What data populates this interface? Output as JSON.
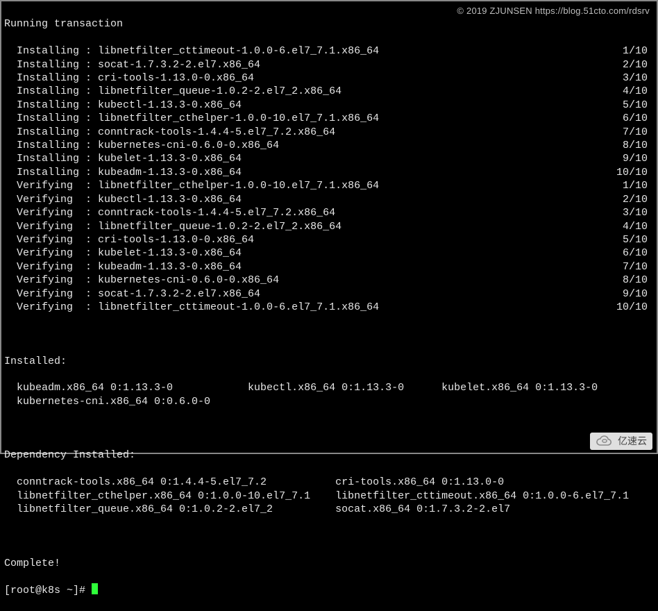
{
  "watermark": "© 2019 ZJUNSEN https://blog.51cto.com/rdsrv",
  "header": "Running transaction",
  "steps": [
    {
      "action": "Installing",
      "pkg": "libnetfilter_cttimeout-1.0.0-6.el7_7.1.x86_64",
      "n": "1/10"
    },
    {
      "action": "Installing",
      "pkg": "socat-1.7.3.2-2.el7.x86_64",
      "n": "2/10"
    },
    {
      "action": "Installing",
      "pkg": "cri-tools-1.13.0-0.x86_64",
      "n": "3/10"
    },
    {
      "action": "Installing",
      "pkg": "libnetfilter_queue-1.0.2-2.el7_2.x86_64",
      "n": "4/10"
    },
    {
      "action": "Installing",
      "pkg": "kubectl-1.13.3-0.x86_64",
      "n": "5/10"
    },
    {
      "action": "Installing",
      "pkg": "libnetfilter_cthelper-1.0.0-10.el7_7.1.x86_64",
      "n": "6/10"
    },
    {
      "action": "Installing",
      "pkg": "conntrack-tools-1.4.4-5.el7_7.2.x86_64",
      "n": "7/10"
    },
    {
      "action": "Installing",
      "pkg": "kubernetes-cni-0.6.0-0.x86_64",
      "n": "8/10"
    },
    {
      "action": "Installing",
      "pkg": "kubelet-1.13.3-0.x86_64",
      "n": "9/10"
    },
    {
      "action": "Installing",
      "pkg": "kubeadm-1.13.3-0.x86_64",
      "n": "10/10"
    },
    {
      "action": "Verifying",
      "pkg": "libnetfilter_cthelper-1.0.0-10.el7_7.1.x86_64",
      "n": "1/10"
    },
    {
      "action": "Verifying",
      "pkg": "kubectl-1.13.3-0.x86_64",
      "n": "2/10"
    },
    {
      "action": "Verifying",
      "pkg": "conntrack-tools-1.4.4-5.el7_7.2.x86_64",
      "n": "3/10"
    },
    {
      "action": "Verifying",
      "pkg": "libnetfilter_queue-1.0.2-2.el7_2.x86_64",
      "n": "4/10"
    },
    {
      "action": "Verifying",
      "pkg": "cri-tools-1.13.0-0.x86_64",
      "n": "5/10"
    },
    {
      "action": "Verifying",
      "pkg": "kubelet-1.13.3-0.x86_64",
      "n": "6/10"
    },
    {
      "action": "Verifying",
      "pkg": "kubeadm-1.13.3-0.x86_64",
      "n": "7/10"
    },
    {
      "action": "Verifying",
      "pkg": "kubernetes-cni-0.6.0-0.x86_64",
      "n": "8/10"
    },
    {
      "action": "Verifying",
      "pkg": "socat-1.7.3.2-2.el7.x86_64",
      "n": "9/10"
    },
    {
      "action": "Verifying",
      "pkg": "libnetfilter_cttimeout-1.0.0-6.el7_7.1.x86_64",
      "n": "10/10"
    }
  ],
  "installed_header": "Installed:",
  "installed": [
    {
      "col1": "kubeadm.x86_64 0:1.13.3-0",
      "col2": "kubectl.x86_64 0:1.13.3-0",
      "col3": "kubelet.x86_64 0:1.13.3-0"
    },
    {
      "col1": "kubernetes-cni.x86_64 0:0.6.0-0",
      "col2": "",
      "col3": ""
    }
  ],
  "dep_header": "Dependency Installed:",
  "deps": [
    {
      "col1": "conntrack-tools.x86_64 0:1.4.4-5.el7_7.2",
      "col2": "cri-tools.x86_64 0:1.13.0-0"
    },
    {
      "col1": "libnetfilter_cthelper.x86_64 0:1.0.0-10.el7_7.1",
      "col2": "libnetfilter_cttimeout.x86_64 0:1.0.0-6.el7_7.1"
    },
    {
      "col1": "libnetfilter_queue.x86_64 0:1.0.2-2.el7_2",
      "col2": "socat.x86_64 0:1.7.3.2-2.el7"
    }
  ],
  "complete": "Complete!",
  "prompt": "[root@k8s ~]# ",
  "logo_text": "亿速云"
}
